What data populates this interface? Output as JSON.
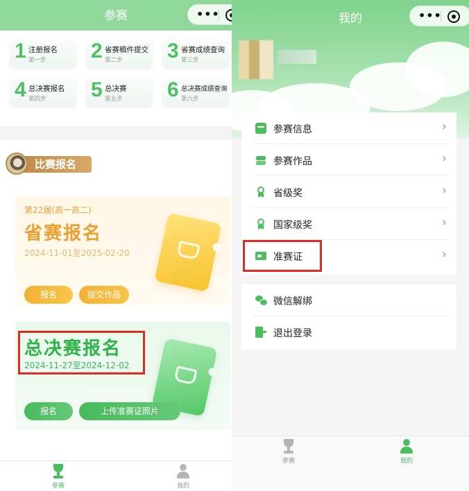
{
  "left": {
    "nav_title": "参赛",
    "capsule": {
      "more": "•••"
    },
    "steps": [
      {
        "num": "1",
        "label": "注册报名",
        "sub": "第一步"
      },
      {
        "num": "2",
        "label": "省赛稿件提交",
        "sub": "第二步"
      },
      {
        "num": "3",
        "label": "省赛成绩查询",
        "sub": "第三步"
      },
      {
        "num": "4",
        "label": "总决赛报名",
        "sub": "第四步"
      },
      {
        "num": "5",
        "label": "总决赛",
        "sub": "第五步"
      },
      {
        "num": "6",
        "label": "总决赛成绩查询",
        "sub": "第六步"
      }
    ],
    "section_title": "比赛报名",
    "provincial": {
      "edition": "第22届(高一高二)",
      "title": "省赛报名",
      "dates": "2024-11-01至2025-02-20",
      "btn_register": "报名",
      "btn_submit": "提交作品"
    },
    "final": {
      "title": "总决赛报名",
      "dates": "2024-11-27至2024-12-02",
      "btn_register": "报名",
      "btn_upload": "上传准赛证照片"
    },
    "tabs": [
      {
        "label": "参赛",
        "active": true
      },
      {
        "label": "我的",
        "active": false
      }
    ]
  },
  "right": {
    "nav_title": "我的",
    "capsule": {
      "more": "•••"
    },
    "menu": [
      {
        "label": "参赛信息",
        "icon": "envelope-icon"
      },
      {
        "label": "参赛作品",
        "icon": "layers-icon"
      },
      {
        "label": "省级奖",
        "icon": "award-icon"
      },
      {
        "label": "国家级奖",
        "icon": "award-icon"
      },
      {
        "label": "准赛证",
        "icon": "id-card-icon"
      }
    ],
    "menu2": [
      {
        "label": "微信解绑",
        "icon": "wechat-icon"
      },
      {
        "label": "退出登录",
        "icon": "logout-icon"
      }
    ],
    "tabs": [
      {
        "label": "参赛",
        "active": false
      },
      {
        "label": "我的",
        "active": true
      }
    ]
  },
  "colors": {
    "brand_green": "#4bbd5f",
    "orange": "#f2b033",
    "highlight_red": "#e22a22",
    "inactive_gray": "#b5b5b5"
  }
}
